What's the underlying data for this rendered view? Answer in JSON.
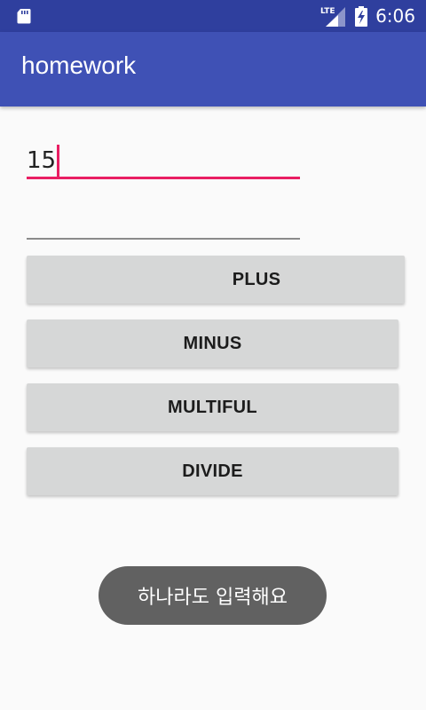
{
  "status_bar": {
    "time": "6:06",
    "network": "LTE",
    "icons": [
      "sd-card-icon",
      "lte-signal-icon",
      "battery-charging-icon"
    ]
  },
  "app_bar": {
    "title": "homework"
  },
  "inputs": {
    "first": {
      "value": "15"
    },
    "second": {
      "value": ""
    }
  },
  "buttons": {
    "plus": "PLUS",
    "minus": "MINUS",
    "multiful": "MULTIFUL",
    "divide": "DIVIDE"
  },
  "toast": {
    "message": "하나라도 입력해요"
  },
  "colors": {
    "status_bar": "#2f3f9e",
    "app_bar": "#3f51b5",
    "accent": "#e91e63",
    "button": "#d6d7d7",
    "toast": "#616161"
  }
}
